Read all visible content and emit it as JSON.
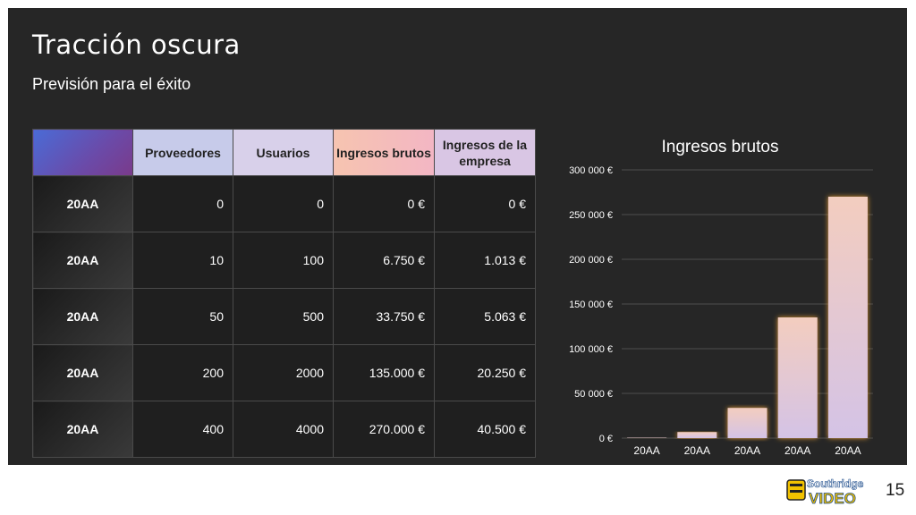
{
  "slide": {
    "title": "Tracción oscura",
    "subtitle": "Previsión para el éxito",
    "page_number": "15"
  },
  "table": {
    "headers": [
      "",
      "Proveedores",
      "Usuarios",
      "Ingresos brutos",
      "Ingresos de la empresa"
    ],
    "rows": [
      [
        "20AA",
        "0",
        "0",
        "0 €",
        "0 €"
      ],
      [
        "20AA",
        "10",
        "100",
        "6.750 €",
        "1.013 €"
      ],
      [
        "20AA",
        "50",
        "500",
        "33.750 €",
        "5.063 €"
      ],
      [
        "20AA",
        "200",
        "2000",
        "135.000 €",
        "20.250 €"
      ],
      [
        "20AA",
        "400",
        "4000",
        "270.000 €",
        "40.500 €"
      ]
    ]
  },
  "chart_data": {
    "type": "bar",
    "title": "Ingresos brutos",
    "categories": [
      "20AA",
      "20AA",
      "20AA",
      "20AA",
      "20AA"
    ],
    "values": [
      0,
      6750,
      33750,
      135000,
      270000
    ],
    "ylim": [
      0,
      300000
    ],
    "yticks": [
      0,
      50000,
      100000,
      150000,
      200000,
      250000,
      300000
    ],
    "ytick_labels": [
      "0 €",
      "50 000 €",
      "100 000 €",
      "150 000 €",
      "200 000 €",
      "250 000 €",
      "300 000 €"
    ],
    "grid": true,
    "bar_color": "#f3cdbf",
    "bar_glow": "#f0a030"
  },
  "logo": {
    "line1": "Southridge",
    "line2": "VIDEO"
  }
}
